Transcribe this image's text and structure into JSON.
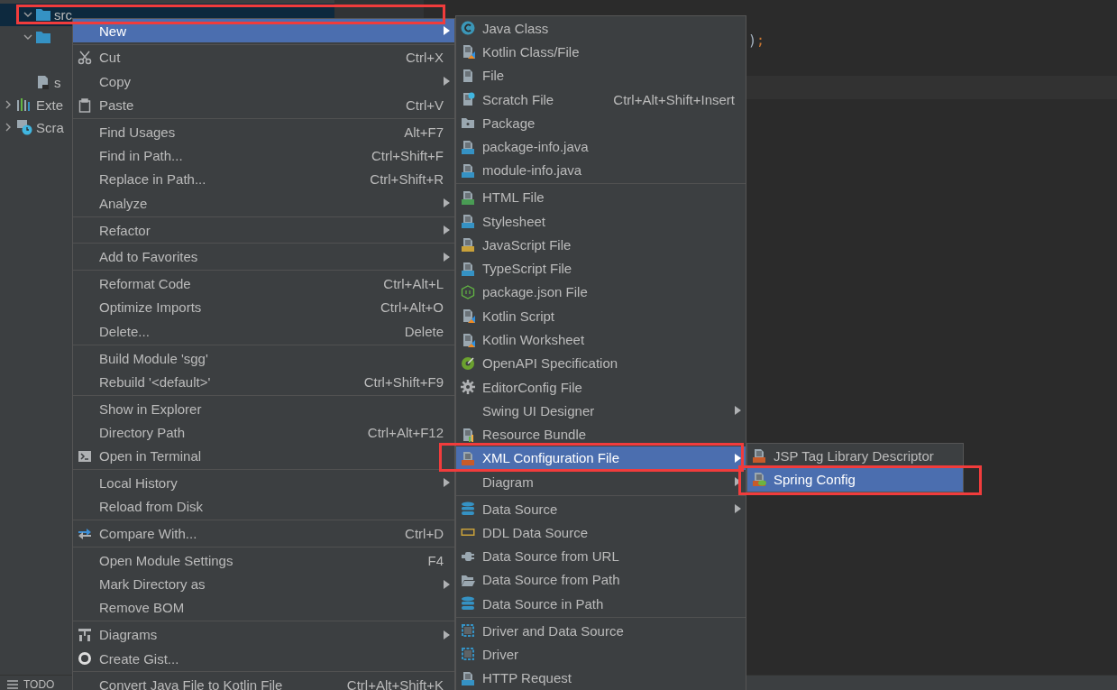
{
  "project_tree": {
    "items": [
      {
        "kind": "folder",
        "label": "src",
        "selected": true,
        "expanded": true,
        "children": [
          {
            "kind": "folder",
            "expanded": true
          },
          {
            "kind": "file",
            "label": "s"
          }
        ]
      },
      {
        "kind": "library",
        "label": "Exte",
        "selected": false,
        "expanded": false
      },
      {
        "kind": "scratches",
        "label": "Scra",
        "selected": false,
        "expanded": false
      }
    ]
  },
  "editor": {
    "lines": [
      {
        "kind": "fragment",
        "tokens": [
          {
            "kind": "plain",
            "text": ")"
          },
          {
            "kind": "keyword",
            "text": ";"
          }
        ]
      },
      {
        "kind": "blank"
      },
      {
        "kind": "current"
      }
    ]
  },
  "context_menu": {
    "groups": [
      {
        "items": [
          {
            "label": "New",
            "selected": true,
            "has_submenu": true
          }
        ]
      },
      {
        "items": [
          {
            "label": "Cut",
            "shortcut": "Ctrl+X",
            "selected": false,
            "has_submenu": false
          },
          {
            "label": "Copy",
            "selected": false,
            "has_submenu": true
          },
          {
            "label": "Paste",
            "shortcut": "Ctrl+V",
            "selected": false,
            "has_submenu": false
          }
        ]
      },
      {
        "items": [
          {
            "label": "Find Usages",
            "shortcut": "Alt+F7",
            "selected": false,
            "has_submenu": false
          },
          {
            "label": "Find in Path...",
            "shortcut": "Ctrl+Shift+F",
            "selected": false,
            "has_submenu": false
          },
          {
            "label": "Replace in Path...",
            "shortcut": "Ctrl+Shift+R",
            "selected": false,
            "has_submenu": false
          },
          {
            "label": "Analyze",
            "selected": false,
            "has_submenu": true
          }
        ]
      },
      {
        "items": [
          {
            "label": "Refactor",
            "selected": false,
            "has_submenu": true
          }
        ]
      },
      {
        "items": [
          {
            "label": "Add to Favorites",
            "selected": false,
            "has_submenu": true
          }
        ]
      },
      {
        "items": [
          {
            "label": "Reformat Code",
            "shortcut": "Ctrl+Alt+L",
            "selected": false,
            "has_submenu": false
          },
          {
            "label": "Optimize Imports",
            "shortcut": "Ctrl+Alt+O",
            "selected": false,
            "has_submenu": false
          },
          {
            "label": "Delete...",
            "shortcut": "Delete",
            "selected": false,
            "has_submenu": false
          }
        ]
      },
      {
        "items": [
          {
            "label": "Build Module 'sgg'",
            "selected": false,
            "has_submenu": false
          },
          {
            "label": "Rebuild '<default>'",
            "shortcut": "Ctrl+Shift+F9",
            "selected": false,
            "has_submenu": false
          }
        ]
      },
      {
        "items": [
          {
            "label": "Show in Explorer",
            "selected": false,
            "has_submenu": false
          },
          {
            "label": "Directory Path",
            "shortcut": "Ctrl+Alt+F12",
            "selected": false,
            "has_submenu": false
          },
          {
            "label": "Open in Terminal",
            "selected": false,
            "has_submenu": false
          }
        ]
      },
      {
        "items": [
          {
            "label": "Local History",
            "selected": false,
            "has_submenu": true
          },
          {
            "label": "Reload from Disk",
            "selected": false,
            "has_submenu": false
          }
        ]
      },
      {
        "items": [
          {
            "label": "Compare With...",
            "shortcut": "Ctrl+D",
            "selected": false,
            "has_submenu": false
          }
        ]
      },
      {
        "items": [
          {
            "label": "Open Module Settings",
            "shortcut": "F4",
            "selected": false,
            "has_submenu": false
          },
          {
            "label": "Mark Directory as",
            "selected": false,
            "has_submenu": true
          },
          {
            "label": "Remove BOM",
            "selected": false,
            "has_submenu": false
          }
        ]
      },
      {
        "items": [
          {
            "label": "Diagrams",
            "selected": false,
            "has_submenu": true
          },
          {
            "label": "Create Gist...",
            "selected": false,
            "has_submenu": false
          }
        ]
      },
      {
        "items": [
          {
            "label": "Convert Java File to Kotlin File",
            "shortcut": "Ctrl+Alt+Shift+K",
            "selected": false,
            "has_submenu": false
          }
        ]
      }
    ]
  },
  "new_submenu": {
    "groups": [
      {
        "items": [
          {
            "label": "Java Class",
            "selected": false,
            "has_submenu": false
          },
          {
            "label": "Kotlin Class/File",
            "selected": false,
            "has_submenu": false
          },
          {
            "label": "File",
            "selected": false,
            "has_submenu": false
          },
          {
            "label": "Scratch File",
            "shortcut": "Ctrl+Alt+Shift+Insert",
            "selected": false,
            "has_submenu": false
          },
          {
            "label": "Package",
            "selected": false,
            "has_submenu": false
          },
          {
            "label": "package-info.java",
            "selected": false,
            "has_submenu": false
          },
          {
            "label": "module-info.java",
            "selected": false,
            "has_submenu": false
          }
        ]
      },
      {
        "items": [
          {
            "label": "HTML File",
            "selected": false,
            "has_submenu": false
          },
          {
            "label": "Stylesheet",
            "selected": false,
            "has_submenu": false
          },
          {
            "label": "JavaScript File",
            "selected": false,
            "has_submenu": false
          },
          {
            "label": "TypeScript File",
            "selected": false,
            "has_submenu": false
          },
          {
            "label": "package.json File",
            "selected": false,
            "has_submenu": false
          },
          {
            "label": "Kotlin Script",
            "selected": false,
            "has_submenu": false
          },
          {
            "label": "Kotlin Worksheet",
            "selected": false,
            "has_submenu": false
          },
          {
            "label": "OpenAPI Specification",
            "selected": false,
            "has_submenu": false
          },
          {
            "label": "EditorConfig File",
            "selected": false,
            "has_submenu": false
          },
          {
            "label": "Swing UI Designer",
            "selected": false,
            "has_submenu": true
          },
          {
            "label": "Resource Bundle",
            "selected": false,
            "has_submenu": false
          },
          {
            "label": "XML Configuration File",
            "selected": true,
            "has_submenu": true
          },
          {
            "label": "Diagram",
            "selected": false,
            "has_submenu": true
          }
        ]
      },
      {
        "items": [
          {
            "label": "Data Source",
            "selected": false,
            "has_submenu": true
          },
          {
            "label": "DDL Data Source",
            "selected": false,
            "has_submenu": false
          },
          {
            "label": "Data Source from URL",
            "selected": false,
            "has_submenu": false
          },
          {
            "label": "Data Source from Path",
            "selected": false,
            "has_submenu": false
          },
          {
            "label": "Data Source in Path",
            "selected": false,
            "has_submenu": false
          }
        ]
      },
      {
        "items": [
          {
            "label": "Driver and Data Source",
            "selected": false,
            "has_submenu": false
          },
          {
            "label": "Driver",
            "selected": false,
            "has_submenu": false
          },
          {
            "label": "HTTP Request",
            "selected": false,
            "has_submenu": false
          }
        ]
      }
    ]
  },
  "xml_submenu": {
    "groups": [
      {
        "items": [
          {
            "label": "JSP Tag Library Descriptor",
            "selected": false,
            "has_submenu": false
          },
          {
            "label": "Spring Config",
            "selected": true,
            "has_submenu": false
          }
        ]
      }
    ]
  },
  "bottom_bar": {
    "tabs": [
      {
        "label": "TODO"
      }
    ]
  }
}
